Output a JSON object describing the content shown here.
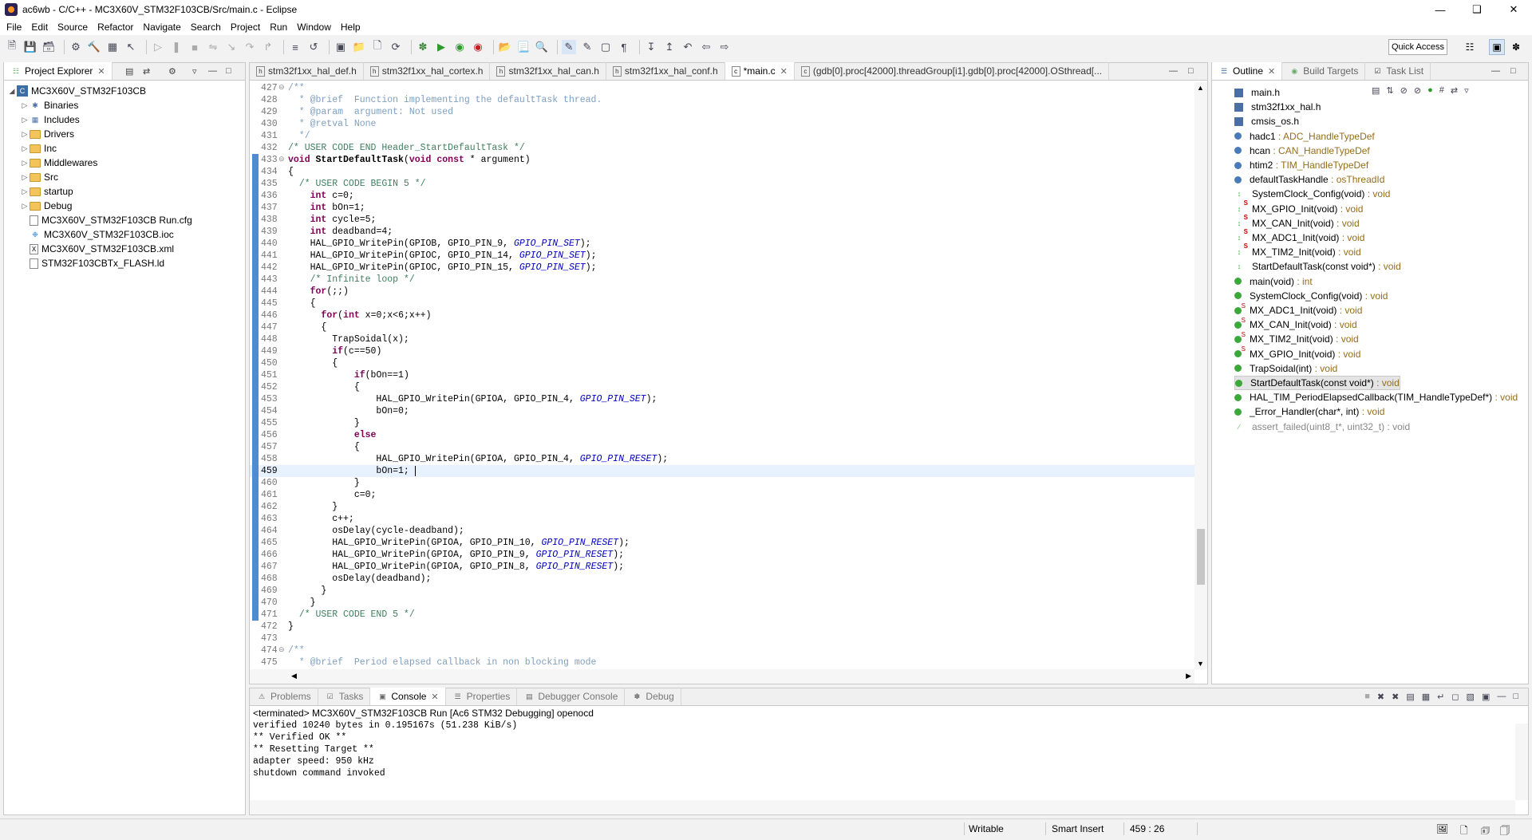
{
  "window": {
    "title": "ac6wb - C/C++ - MC3X60V_STM32F103CB/Src/main.c - Eclipse",
    "controls": [
      "minimize-icon",
      "maximize-icon",
      "close-icon"
    ]
  },
  "menu": [
    "File",
    "Edit",
    "Source",
    "Refactor",
    "Navigate",
    "Search",
    "Project",
    "Run",
    "Window",
    "Help"
  ],
  "toolbar": {
    "quick_access": "Quick Access"
  },
  "project_explorer": {
    "tab": "Project Explorer",
    "root": "MC3X60V_STM32F103CB",
    "items": [
      {
        "label": "Binaries",
        "icon": "binaries-icon"
      },
      {
        "label": "Includes",
        "icon": "includes-icon"
      },
      {
        "label": "Drivers",
        "icon": "folder-icon"
      },
      {
        "label": "Inc",
        "icon": "folder-icon"
      },
      {
        "label": "Middlewares",
        "icon": "folder-icon"
      },
      {
        "label": "Src",
        "icon": "folder-icon"
      },
      {
        "label": "startup",
        "icon": "folder-icon"
      },
      {
        "label": "Debug",
        "icon": "folder-icon"
      }
    ],
    "files": [
      {
        "label": "MC3X60V_STM32F103CB Run.cfg",
        "icon": "cfg-file-icon"
      },
      {
        "label": "MC3X60V_STM32F103CB.ioc",
        "icon": "ioc-file-icon"
      },
      {
        "label": "MC3X60V_STM32F103CB.xml",
        "icon": "xml-file-icon"
      },
      {
        "label": "STM32F103CBTx_FLASH.ld",
        "icon": "ld-file-icon"
      }
    ]
  },
  "editor": {
    "tabs": [
      {
        "label": "stm32f1xx_hal_def.h"
      },
      {
        "label": "stm32f1xx_hal_cortex.h"
      },
      {
        "label": "stm32f1xx_hal_can.h"
      },
      {
        "label": "stm32f1xx_hal_conf.h"
      },
      {
        "label": "*main.c",
        "active": true
      },
      {
        "label": "(gdb[0].proc[42000].threadGroup[i1].gdb[0].proc[42000].OSthread[..."
      }
    ],
    "lines": [
      {
        "n": "427",
        "h": "<span class=\"tg\">/**</span>",
        "fold": "⊖"
      },
      {
        "n": "428",
        "h": "<span class=\"tg\">  * @brief  Function implementing the defaultTask thread.</span>"
      },
      {
        "n": "429",
        "h": "<span class=\"tg\">  * @param  argument: Not used</span>"
      },
      {
        "n": "430",
        "h": "<span class=\"tg\">  * @retval None</span>"
      },
      {
        "n": "431",
        "h": "<span class=\"tg\">  */</span>"
      },
      {
        "n": "432",
        "h": "<span class=\"cm\">/* USER CODE END Header_StartDefaultTask */</span>"
      },
      {
        "n": "433",
        "h": "<span class=\"kw\">void</span> <b>StartDefaultTask</b>(<span class=\"kw\">void</span> <span class=\"kw\">const</span> * argument)",
        "fold": "⊖"
      },
      {
        "n": "434",
        "h": "{"
      },
      {
        "n": "435",
        "h": "  <span class=\"cm\">/* USER CODE BEGIN 5 */</span>"
      },
      {
        "n": "436",
        "h": "    <span class=\"kw\">int</span> c=0;"
      },
      {
        "n": "437",
        "h": "    <span class=\"kw\">int</span> bOn=1;"
      },
      {
        "n": "438",
        "h": "    <span class=\"kw\">int</span> cycle=5;"
      },
      {
        "n": "439",
        "h": "    <span class=\"kw\">int</span> deadband=4;"
      },
      {
        "n": "440",
        "h": "    HAL_GPIO_WritePin(GPIOB, GPIO_PIN_9, <span class=\"mac\">GPIO_PIN_SET</span>);"
      },
      {
        "n": "441",
        "h": "    HAL_GPIO_WritePin(GPIOC, GPIO_PIN_14, <span class=\"mac\">GPIO_PIN_SET</span>);"
      },
      {
        "n": "442",
        "h": "    HAL_GPIO_WritePin(GPIOC, GPIO_PIN_15, <span class=\"mac\">GPIO_PIN_SET</span>);"
      },
      {
        "n": "443",
        "h": "    <span class=\"cm\">/* Infinite loop */</span>"
      },
      {
        "n": "444",
        "h": "    <span class=\"kw\">for</span>(;;)"
      },
      {
        "n": "445",
        "h": "    {"
      },
      {
        "n": "446",
        "h": "      <span class=\"kw\">for</span>(<span class=\"kw\">int</span> x=0;x&lt;6;x++)"
      },
      {
        "n": "447",
        "h": "      {"
      },
      {
        "n": "448",
        "h": "        TrapSoidal(x);"
      },
      {
        "n": "449",
        "h": "        <span class=\"kw\">if</span>(c==50)"
      },
      {
        "n": "450",
        "h": "        {"
      },
      {
        "n": "451",
        "h": "            <span class=\"kw\">if</span>(bOn==1)"
      },
      {
        "n": "452",
        "h": "            {"
      },
      {
        "n": "453",
        "h": "                HAL_GPIO_WritePin(GPIOA, GPIO_PIN_4, <span class=\"mac\">GPIO_PIN_SET</span>);"
      },
      {
        "n": "454",
        "h": "                bOn=0;"
      },
      {
        "n": "455",
        "h": "            }"
      },
      {
        "n": "456",
        "h": "            <span class=\"kw\">else</span>"
      },
      {
        "n": "457",
        "h": "            {"
      },
      {
        "n": "458",
        "h": "                HAL_GPIO_WritePin(GPIOA, GPIO_PIN_4, <span class=\"mac\">GPIO_PIN_RESET</span>);"
      },
      {
        "n": "459",
        "h": "                bOn=1; <span style=\"border-left:1px solid #000\"> </span>",
        "cur": true
      },
      {
        "n": "460",
        "h": "            }"
      },
      {
        "n": "461",
        "h": "            c=0;"
      },
      {
        "n": "462",
        "h": "        }"
      },
      {
        "n": "463",
        "h": "        c++;"
      },
      {
        "n": "464",
        "h": "        osDelay(cycle-deadband);"
      },
      {
        "n": "465",
        "h": "        HAL_GPIO_WritePin(GPIOA, GPIO_PIN_10, <span class=\"mac\">GPIO_PIN_RESET</span>);"
      },
      {
        "n": "466",
        "h": "        HAL_GPIO_WritePin(GPIOA, GPIO_PIN_9, <span class=\"mac\">GPIO_PIN_RESET</span>);"
      },
      {
        "n": "467",
        "h": "        HAL_GPIO_WritePin(GPIOA, GPIO_PIN_8, <span class=\"mac\">GPIO_PIN_RESET</span>);"
      },
      {
        "n": "468",
        "h": "        osDelay(deadband);"
      },
      {
        "n": "469",
        "h": "      }"
      },
      {
        "n": "470",
        "h": "    }"
      },
      {
        "n": "471",
        "h": "  <span class=\"cm\">/* USER CODE END 5 */</span>"
      },
      {
        "n": "472",
        "h": "}"
      },
      {
        "n": "473",
        "h": ""
      },
      {
        "n": "474",
        "h": "<span class=\"tg\">/**</span>",
        "fold": "⊖"
      },
      {
        "n": "475",
        "h": "<span class=\"tg\">  * @brief  Period elapsed callback in non blocking mode</span>"
      }
    ]
  },
  "outline": {
    "tabs": [
      {
        "label": "Outline",
        "active": true
      },
      {
        "label": "Build Targets"
      },
      {
        "label": "Task List"
      }
    ],
    "items": [
      {
        "name": "main.h",
        "type": "",
        "kind": "inc"
      },
      {
        "name": "stm32f1xx_hal.h",
        "type": "",
        "kind": "inc"
      },
      {
        "name": "cmsis_os.h",
        "type": "",
        "kind": "inc"
      },
      {
        "name": "hadc1",
        "type": " : ADC_HandleTypeDef",
        "kind": "field"
      },
      {
        "name": "hcan",
        "type": " : CAN_HandleTypeDef",
        "kind": "field"
      },
      {
        "name": "htim2",
        "type": " : TIM_HandleTypeDef",
        "kind": "field"
      },
      {
        "name": "defaultTaskHandle",
        "type": " : osThreadId",
        "kind": "field"
      },
      {
        "name": "SystemClock_Config(void)",
        "type": " : void",
        "kind": "dec"
      },
      {
        "name": "MX_GPIO_Init(void)",
        "type": " : void",
        "kind": "dec stat"
      },
      {
        "name": "MX_CAN_Init(void)",
        "type": " : void",
        "kind": "dec stat"
      },
      {
        "name": "MX_ADC1_Init(void)",
        "type": " : void",
        "kind": "dec stat"
      },
      {
        "name": "MX_TIM2_Init(void)",
        "type": " : void",
        "kind": "dec stat"
      },
      {
        "name": "StartDefaultTask(const void*)",
        "type": " : void",
        "kind": "dec"
      },
      {
        "name": "main(void)",
        "type": " : int",
        "kind": "pub"
      },
      {
        "name": "SystemClock_Config(void)",
        "type": " : void",
        "kind": "pub"
      },
      {
        "name": "MX_ADC1_Init(void)",
        "type": " : void",
        "kind": "pub stat"
      },
      {
        "name": "MX_CAN_Init(void)",
        "type": " : void",
        "kind": "pub stat"
      },
      {
        "name": "MX_TIM2_Init(void)",
        "type": " : void",
        "kind": "pub stat"
      },
      {
        "name": "MX_GPIO_Init(void)",
        "type": " : void",
        "kind": "pub stat"
      },
      {
        "name": "TrapSoidal(int)",
        "type": " : void",
        "kind": "pub"
      },
      {
        "name": "StartDefaultTask(const void*)",
        "type": " : void",
        "kind": "pub",
        "selected": true
      },
      {
        "name": "HAL_TIM_PeriodElapsedCallback(TIM_HandleTypeDef*)",
        "type": " : void",
        "kind": "pub"
      },
      {
        "name": "_Error_Handler(char*, int)",
        "type": " : void",
        "kind": "pub"
      },
      {
        "name": "assert_failed(uint8_t*, uint32_t)",
        "type": " : void",
        "kind": "grey"
      }
    ]
  },
  "console": {
    "tabs": [
      {
        "label": "Problems"
      },
      {
        "label": "Tasks"
      },
      {
        "label": "Console",
        "active": true
      },
      {
        "label": "Properties"
      },
      {
        "label": "Debugger Console"
      },
      {
        "label": "Debug"
      }
    ],
    "header": "<terminated> MC3X60V_STM32F103CB Run [Ac6 STM32 Debugging] openocd",
    "lines": [
      "verified 10240 bytes in 0.195167s (51.238 KiB/s)",
      "** Verified OK **",
      "** Resetting Target **",
      "adapter speed: 950 kHz",
      "shutdown command invoked"
    ]
  },
  "status": {
    "writable": "Writable",
    "insert": "Smart Insert",
    "position": "459 : 26"
  }
}
